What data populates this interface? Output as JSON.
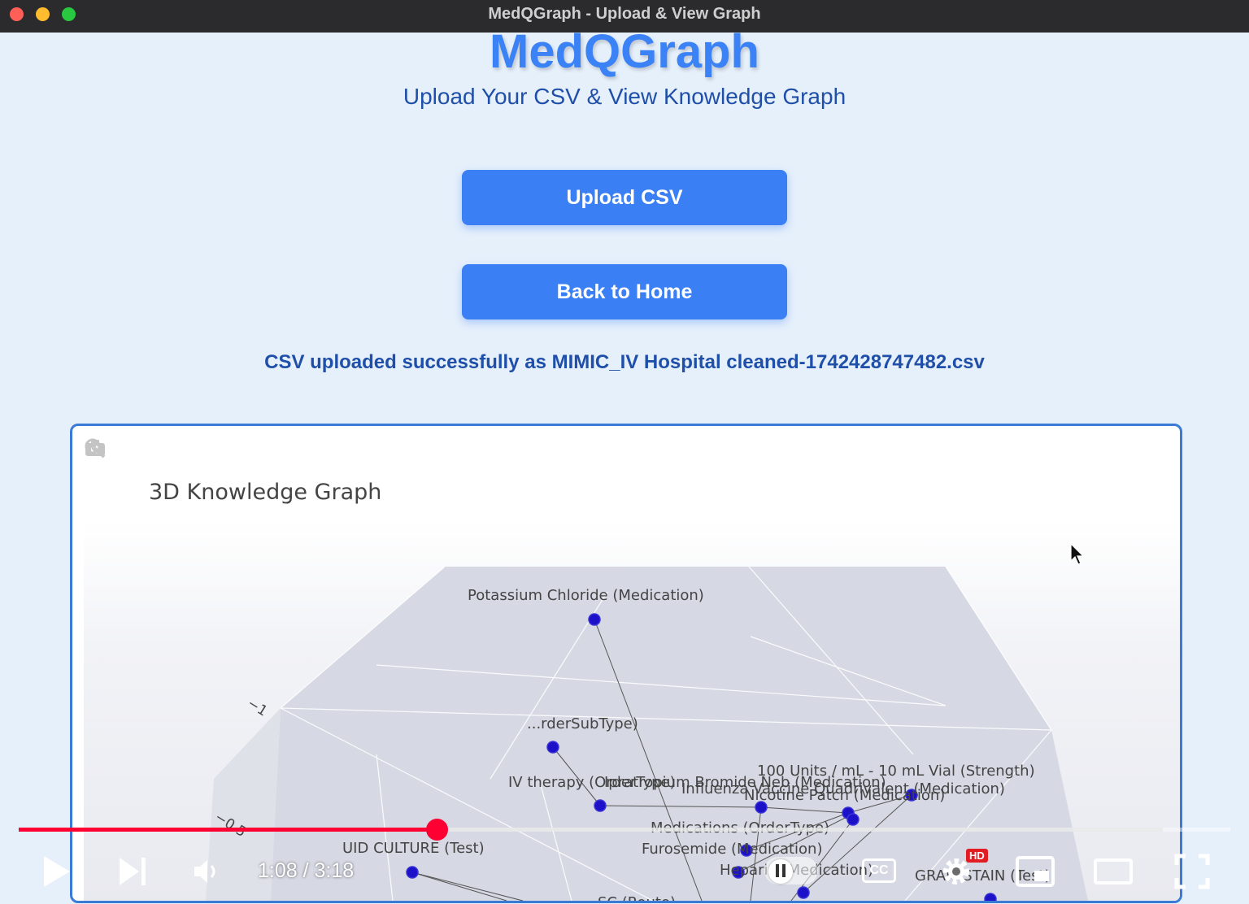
{
  "window": {
    "title": "MedQGraph - Upload & View Graph"
  },
  "header": {
    "app_title": "MedQGraph",
    "subtitle": "Upload Your CSV & View Knowledge Graph"
  },
  "actions": {
    "upload_label": "Upload CSV",
    "home_label": "Back to Home"
  },
  "status_message": "CSV uploaded successfully as MIMIC_IV Hospital cleaned-1742428747482.csv",
  "graph": {
    "title": "3D Knowledge Graph",
    "axis_ticks": [
      "−1",
      "−0.5"
    ],
    "node_labels": {
      "potassium": "Potassium Chloride (Medication)",
      "ordersubtype": "...rderSubType)",
      "iv_therapy": "IV therapy (OrderType)",
      "ipratropium": "Ipratropium Bromide Neb (Medication)",
      "strength": "100 Units / mL - 10 mL Vial (Strength)",
      "influenza": "Influenza Vaccine Quadrivalent (Medication)",
      "nicotine": "Nicotine Patch (Medication)",
      "medications": "Medications (OrderType)",
      "furosemide": "Furosemide (Medication)",
      "uid_culture": "UID CULTURE (Test)",
      "heparin": "Heparin (Medication)",
      "gram_stain": "GRAM STAIN (Test)",
      "route": "SC (Route)"
    },
    "colors": {
      "node": "#1c10c8",
      "edge": "#555555",
      "scene": "#d9dce6"
    }
  },
  "video": {
    "time_display": "1:08 / 3:18",
    "progress_fraction": 0.345,
    "buffered_fraction": 0.944,
    "hd_badge": "HD",
    "cc_label": "CC",
    "colors": {
      "played": "#ff0033"
    },
    "icons": [
      "play-icon",
      "next-icon",
      "volume-icon",
      "autoplay-toggle",
      "subtitles-icon",
      "settings-icon",
      "miniplayer-icon",
      "theater-icon",
      "fullscreen-icon"
    ]
  }
}
